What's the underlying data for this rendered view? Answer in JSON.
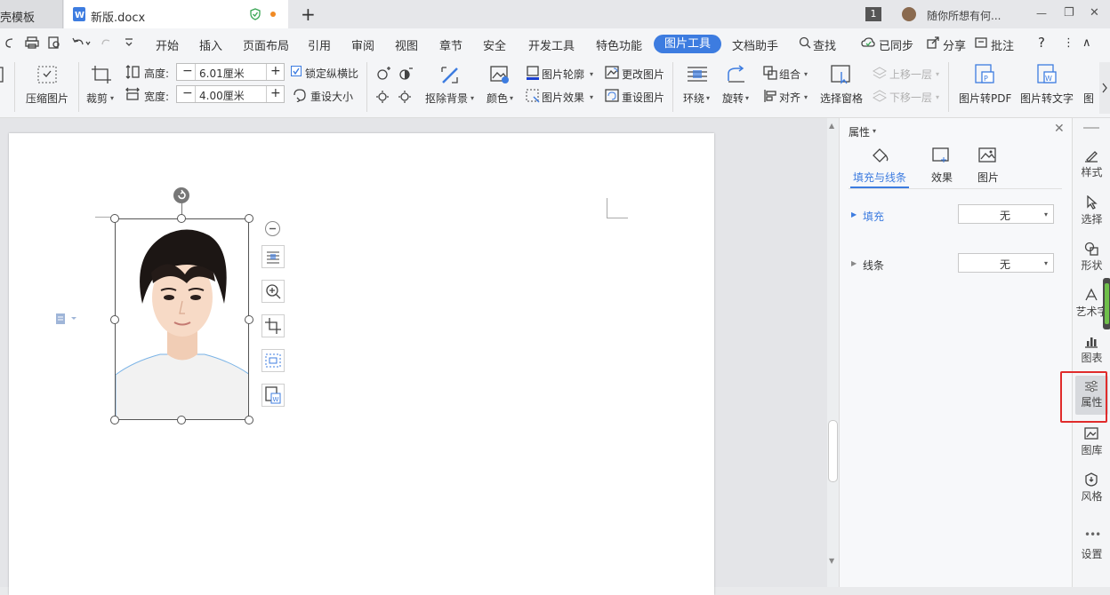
{
  "titlebar": {
    "prev_tab": "壳模板",
    "active_tab": "新版.docx",
    "new_tab_symbol": "+",
    "badge": "1",
    "search_hint": "随你所想有何...",
    "min": "—",
    "restore": "❐",
    "close": "✕"
  },
  "menu": {
    "items": [
      "开始",
      "插入",
      "页面布局",
      "引用",
      "审阅",
      "视图",
      "章节",
      "安全",
      "开发工具",
      "特色功能",
      "图片工具",
      "文档助手",
      "查找"
    ],
    "sync": "已同步",
    "share": "分享",
    "annotate": "批注",
    "help": "?",
    "more": "⋮",
    "collapse": "∧"
  },
  "ribbon": {
    "compress": "压缩图片",
    "crop": "裁剪",
    "height_label": "高度:",
    "height_value": "6.01厘米",
    "width_label": "宽度:",
    "width_value": "4.00厘米",
    "minus": "−",
    "plus": "+",
    "lock_ratio": "锁定纵横比",
    "reset_size": "重设大小",
    "remove_bg": "抠除背景",
    "color": "颜色",
    "outline": "图片轮廓",
    "effect": "图片效果",
    "change_pic": "更改图片",
    "reset_pic": "重设图片",
    "wrap": "环绕",
    "rotate": "旋转",
    "group": "组合",
    "align": "对齐",
    "selection_pane": "选择窗格",
    "bring_forward": "上移一层",
    "send_backward": "下移一层",
    "to_pdf": "图片转PDF",
    "to_text": "图片转文字",
    "more_cut": "图"
  },
  "props": {
    "title": "属性",
    "tabs": [
      "填充与线条",
      "效果",
      "图片"
    ],
    "fill_label": "填充",
    "fill_value": "无",
    "line_label": "线条",
    "line_value": "无"
  },
  "right_toolbar": [
    "样式",
    "选择",
    "形状",
    "艺术字",
    "图表",
    "属性",
    "图库",
    "风格",
    "设置"
  ],
  "colors": {
    "accent": "#3d7ce0",
    "highlight_box": "#e02b2b"
  }
}
